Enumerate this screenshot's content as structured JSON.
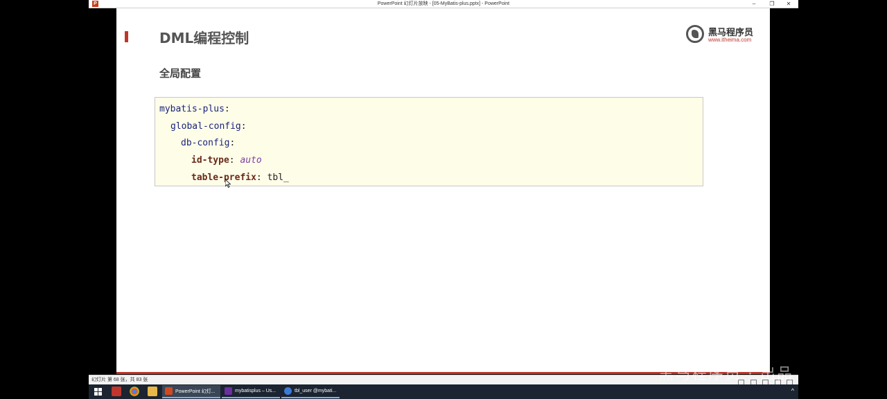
{
  "window": {
    "title": "PowerPoint 幻灯片放映 - [05-MyBatis-plus.pptx] - PowerPoint",
    "app_icon_letter": "P",
    "minimize": "–",
    "restore": "❐",
    "close": "✕"
  },
  "slide": {
    "title": "DML编程控制",
    "subtitle": "全局配置",
    "logo": {
      "name": "黑马程序员",
      "url": "www.itheima.com"
    },
    "code": [
      {
        "key": "mybatis-plus",
        "sep": ":",
        "value": ""
      },
      {
        "key": "global-config",
        "sep": ":",
        "value": ""
      },
      {
        "key": "db-config",
        "sep": ":",
        "value": ""
      },
      {
        "key": "id-type",
        "sep": ": ",
        "value": "auto"
      },
      {
        "key": "table-prefix",
        "sep": ": ",
        "value": "tbl_"
      }
    ],
    "colors": {
      "accent": "#c0362c",
      "code_bg": "#fefde8"
    }
  },
  "statusbar": {
    "slide_info": "幻灯片 第 68 张，共 83 张"
  },
  "watermark": "黑马程序员 · 出品",
  "taskbar": {
    "apps": [
      {
        "label": "PowerPoint 幻灯...",
        "icon": "powerpoint-icon"
      },
      {
        "label": "mybatisplus – Us...",
        "icon": "intellij-icon"
      },
      {
        "label": "tbl_user @mybati...",
        "icon": "datagrip-icon"
      }
    ],
    "tray_chevron": "^"
  }
}
